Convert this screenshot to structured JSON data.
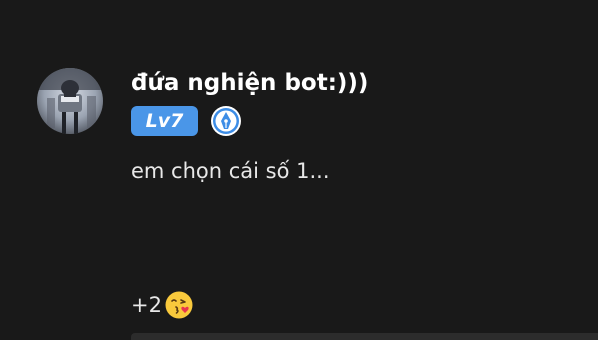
{
  "comment": {
    "author": {
      "name": "đứa nghiện bot:)))",
      "avatar_icon": "avatar-photo",
      "level_label": "Lv7",
      "level_color": "#4a96e8",
      "badge_icon": "fountain-pen-icon"
    },
    "text": "em chọn cái số 1...",
    "reactions": {
      "count_label": "+2",
      "emoji_icon": "face-blowing-kiss-icon"
    }
  },
  "colors": {
    "background": "#191919",
    "text": "#e8e8e8",
    "username": "#ffffff"
  }
}
